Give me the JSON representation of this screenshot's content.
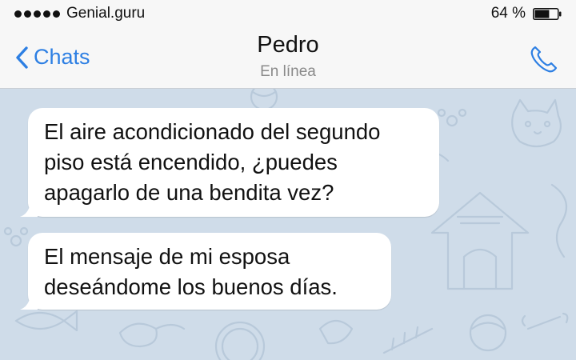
{
  "status_bar": {
    "carrier": "Genial.guru",
    "battery_percent": "64 %",
    "battery_level": 0.64
  },
  "nav": {
    "back_label": "Chats",
    "contact_name": "Pedro",
    "contact_status": "En línea"
  },
  "icons": {
    "back": "chevron-left-icon",
    "call": "phone-icon",
    "battery": "battery-icon",
    "signal": "signal-dots-icon"
  },
  "colors": {
    "accent": "#2d7fe3",
    "chat_background": "#cfdce9",
    "bubble": "#ffffff"
  },
  "messages": [
    {
      "direction": "incoming",
      "text": "El aire acondicionado del segundo\npiso está encendido, ¿puedes\napagarlo de una bendita vez?"
    },
    {
      "direction": "incoming",
      "text": "El mensaje de mi esposa\ndeseándome los buenos días."
    }
  ]
}
